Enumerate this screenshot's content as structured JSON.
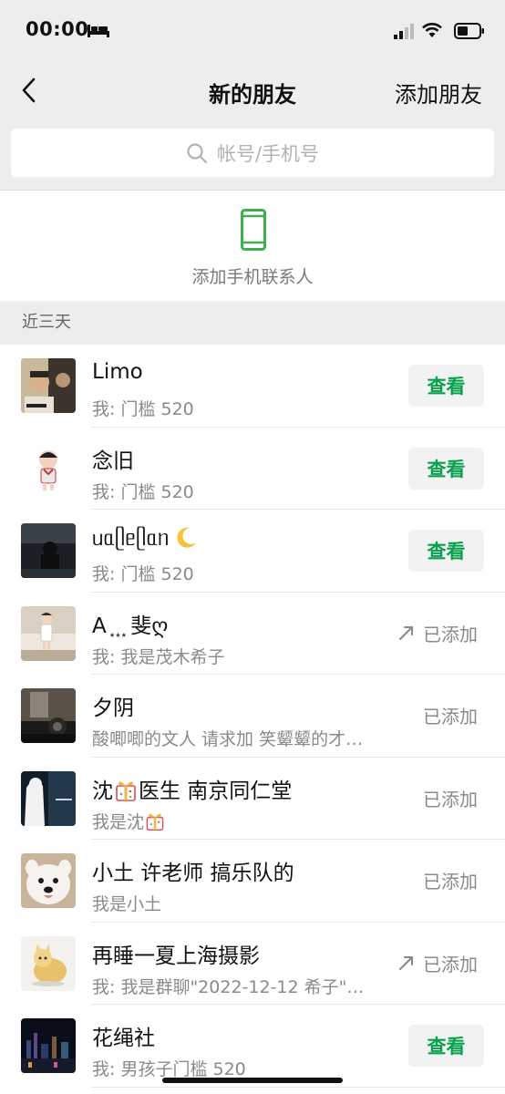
{
  "status_bar": {
    "time": "00:00"
  },
  "navbar": {
    "title": "新的朋友",
    "action": "添加朋友"
  },
  "search": {
    "placeholder": "帐号/手机号"
  },
  "add_contacts": {
    "label": "添加手机联系人"
  },
  "section": {
    "title": "近三天"
  },
  "rows": [
    {
      "name": "Limo",
      "message": "我: 门槛 520",
      "status": "查看",
      "avatar": "avatar-photo"
    },
    {
      "name": "念旧",
      "message": "我: 门槛 520",
      "status": "查看",
      "avatar": "avatar-cartoon"
    },
    {
      "name": "ᥙᥲᥫᥱᥫᥲᥒ",
      "message": "我: 门槛 520",
      "status": "查看",
      "avatar": "avatar-dark"
    },
    {
      "name": "A ͙ ͙ ͙ 斐ღ",
      "message": "我: 我是茂木希子",
      "status": "已添加",
      "avatar": "avatar-girl"
    },
    {
      "name": "夕阴",
      "message": "酸唧唧的文人 请求加 笑颦颦的才…",
      "status": "已添加",
      "avatar": "avatar-bw"
    },
    {
      "name": "沈",
      "name_suffix": "医生 南京同仁堂",
      "message": "我是沈",
      "status": "已添加",
      "avatar": "avatar-night"
    },
    {
      "name": "小土 许老师 搞乐队的",
      "message": "我是小土",
      "status": "已添加",
      "avatar": "avatar-dog"
    },
    {
      "name": "再睡一夏上海摄影",
      "message": "我: 我是群聊\"2022-12-12 希子\"…",
      "status": "已添加",
      "avatar": "avatar-cat"
    },
    {
      "name": "花绳社",
      "message": "我: 男孩子门槛 520",
      "status": "查看",
      "avatar": "avatar-city"
    }
  ],
  "colors": {
    "accent": "#07a14b",
    "background": "#ededed"
  }
}
